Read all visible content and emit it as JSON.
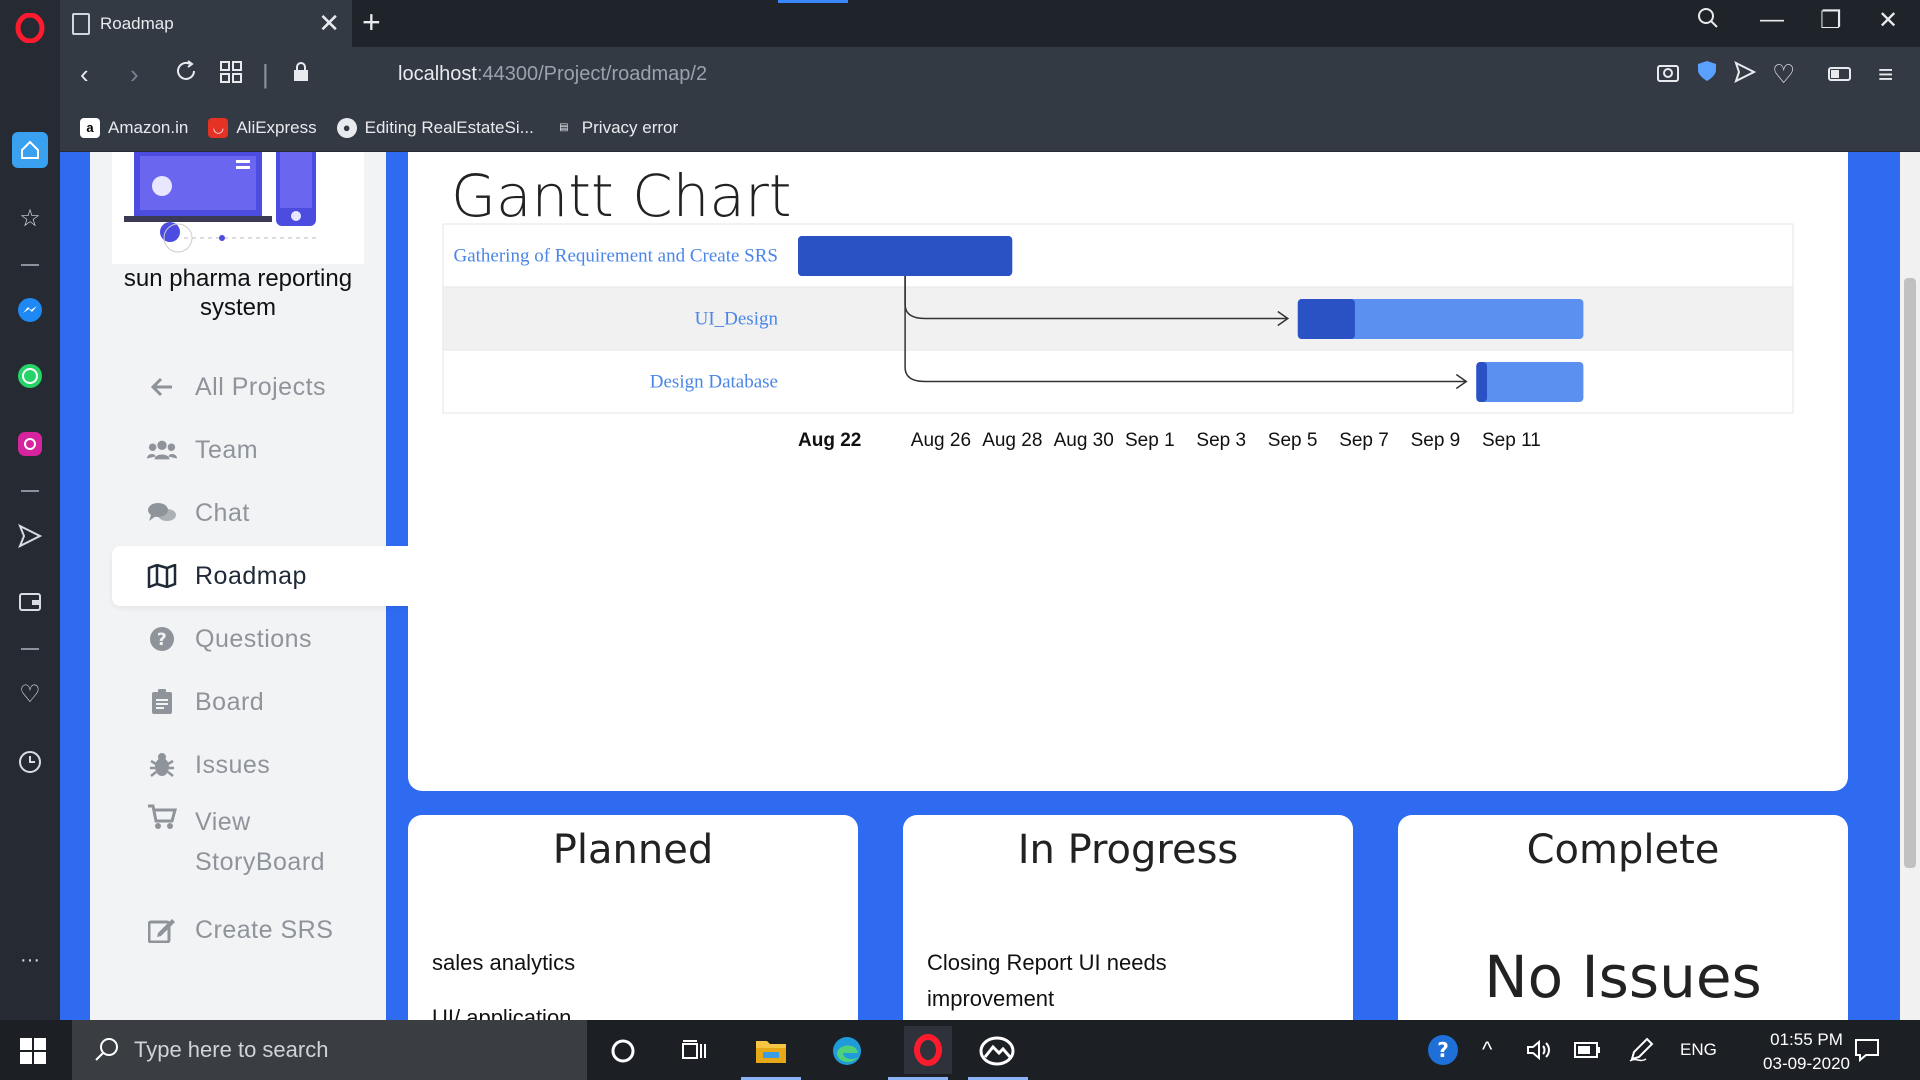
{
  "browser": {
    "tab_title": "Roadmap",
    "url_host": "localhost",
    "url_path": ":44300/Project/roadmap/2",
    "bookmarks": [
      {
        "label": "Amazon.in"
      },
      {
        "label": "AliExpress"
      },
      {
        "label": "Editing RealEstateSi..."
      },
      {
        "label": "Privacy error"
      }
    ]
  },
  "sidebar": {
    "project_name": "sun pharma reporting system",
    "items": [
      {
        "label": "All Projects",
        "icon": "arrow-left-icon"
      },
      {
        "label": "Team",
        "icon": "users-icon"
      },
      {
        "label": "Chat",
        "icon": "comments-icon"
      },
      {
        "label": "Roadmap",
        "icon": "map-icon",
        "active": true
      },
      {
        "label": "Questions",
        "icon": "question-icon"
      },
      {
        "label": "Board",
        "icon": "clipboard-icon"
      },
      {
        "label": "Issues",
        "icon": "bug-icon"
      },
      {
        "label": "View",
        "label2": "StoryBoard",
        "icon": "cart-icon"
      },
      {
        "label": "Create SRS",
        "icon": "edit-icon"
      }
    ]
  },
  "gantt": {
    "title": "Gantt Chart"
  },
  "chart_data": {
    "type": "gantt",
    "title": "Gantt Chart",
    "tasks": [
      {
        "name": "Gathering of Requirement and Create SRS",
        "start": "2020-08-22",
        "end": "2020-08-28",
        "progress": 1.0,
        "depends_on": null
      },
      {
        "name": "UI_Design",
        "start": "2020-09-05",
        "end": "2020-09-13",
        "progress": 0.2,
        "depends_on": "Gathering of Requirement and Create SRS"
      },
      {
        "name": "Design Database",
        "start": "2020-09-10",
        "end": "2020-09-13",
        "progress": 0.1,
        "depends_on": "Gathering of Requirement and Create SRS"
      }
    ],
    "axis_labels": [
      "Aug 22",
      "Aug 26",
      "Aug 28",
      "Aug 30",
      "Sep 1",
      "Sep 3",
      "Sep 5",
      "Sep 7",
      "Sep 9",
      "Sep 11"
    ],
    "axis_dates": [
      "2020-08-22",
      "2020-08-26",
      "2020-08-28",
      "2020-08-30",
      "2020-09-01",
      "2020-09-03",
      "2020-09-05",
      "2020-09-07",
      "2020-09-09",
      "2020-09-11"
    ],
    "bold_label": "Aug 22",
    "colors": {
      "bar_dark": "#2b52c4",
      "bar_light": "#5b90f0",
      "label": "#4a86e8",
      "alt_row": "#f1f1f1"
    }
  },
  "status": {
    "planned": {
      "title": "Planned",
      "item": "sales analytics",
      "item_cut": "UI/ application"
    },
    "in_progress": {
      "title": "In Progress",
      "item": "Closing Report UI needs improvement"
    },
    "complete": {
      "title": "Complete",
      "empty": "No Issues"
    }
  },
  "taskbar": {
    "search_placeholder": "Type here to search",
    "lang": "ENG",
    "time": "01:55 PM",
    "date": "03-09-2020"
  }
}
